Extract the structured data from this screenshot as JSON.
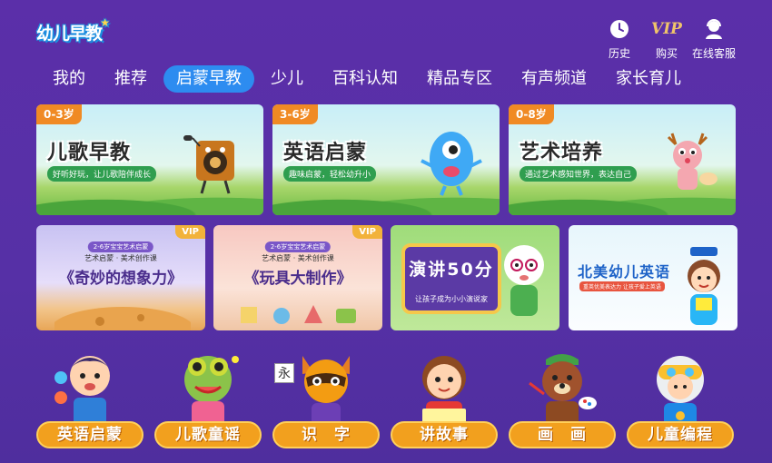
{
  "header": {
    "logo_text": "幼儿早教",
    "buttons": [
      {
        "label": "历史",
        "icon": "clock-icon"
      },
      {
        "label": "购买",
        "icon": "vip-icon",
        "icon_text": "VIP"
      },
      {
        "label": "在线客服",
        "icon": "headset-icon"
      }
    ]
  },
  "tabs": [
    {
      "label": "我的",
      "active": false
    },
    {
      "label": "推荐",
      "active": false
    },
    {
      "label": "启蒙早教",
      "active": true
    },
    {
      "label": "少儿",
      "active": false
    },
    {
      "label": "百科认知",
      "active": false
    },
    {
      "label": "精品专区",
      "active": false
    },
    {
      "label": "有声频道",
      "active": false
    },
    {
      "label": "家长育儿",
      "active": false
    }
  ],
  "big_cards": [
    {
      "age": "0-3岁",
      "title": "儿歌早教",
      "subtitle": "好听好玩，让儿歌陪伴成长"
    },
    {
      "age": "3-6岁",
      "title": "英语启蒙",
      "subtitle": "趣味启蒙，轻松幼升小"
    },
    {
      "age": "0-8岁",
      "title": "艺术培养",
      "subtitle": "通过艺术感知世界，表达自己"
    }
  ],
  "mid_cards": [
    {
      "vip": "VIP",
      "tag": "2-6岁宝宝艺术启蒙",
      "sub": "艺术启蒙 · 美术创作课",
      "title": "《奇妙的想象力》"
    },
    {
      "vip": "VIP",
      "tag": "2-6岁宝宝艺术启蒙",
      "sub": "艺术启蒙 · 美术创作课",
      "title": "《玩具大制作》"
    },
    {
      "title": "演讲50分",
      "sub": "让孩子成为小小演说家"
    },
    {
      "title": "北美幼儿英语",
      "sub": "重英优美表达力 让孩子爱上英语"
    }
  ],
  "bottom_items": [
    {
      "label": "英语启蒙"
    },
    {
      "label": "儿歌童谣"
    },
    {
      "label": "识　字",
      "card_text": "永"
    },
    {
      "label": "讲故事"
    },
    {
      "label": "画　画"
    },
    {
      "label": "儿童编程"
    }
  ],
  "colors": {
    "background": "#5a2ea8",
    "active_tab": "#2d8cf0",
    "age_badge": "#f08a24",
    "vip_badge": "#f2b23a",
    "bottom_label": "#f2a01e"
  }
}
